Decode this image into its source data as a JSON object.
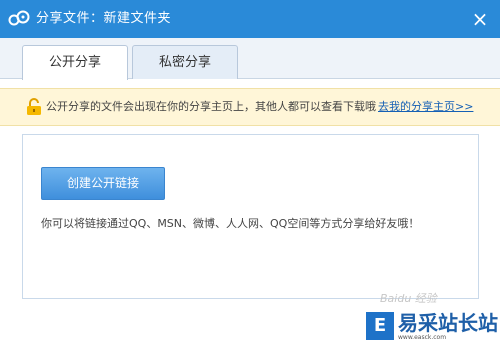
{
  "window": {
    "title": "分享文件：新建文件夹",
    "close_glyph": "×",
    "logo_icon": "cloud-link-icon"
  },
  "tabs": [
    {
      "label": "公开分享",
      "active": true
    },
    {
      "label": "私密分享",
      "active": false
    }
  ],
  "notice": {
    "icon": "lock-icon",
    "text": "公开分享的文件会出现在你的分享主页上，其他人都可以查看下载哦",
    "link": "去我的分享主页>>"
  },
  "panel": {
    "button_label": "创建公开链接",
    "description": "你可以将链接通过QQ、MSN、微博、人人网、QQ空间等方式分享给好友哦！"
  },
  "watermark": {
    "faint_text": "Baidu 经验",
    "brand_badge": "E",
    "brand_name": "易采站长站",
    "brand_url": "www.easck.com"
  },
  "colors": {
    "titlebar": "#2a8ad8",
    "button": "#4a9ae3",
    "link": "#1560b5",
    "notice_bg": "#fff6d8"
  }
}
